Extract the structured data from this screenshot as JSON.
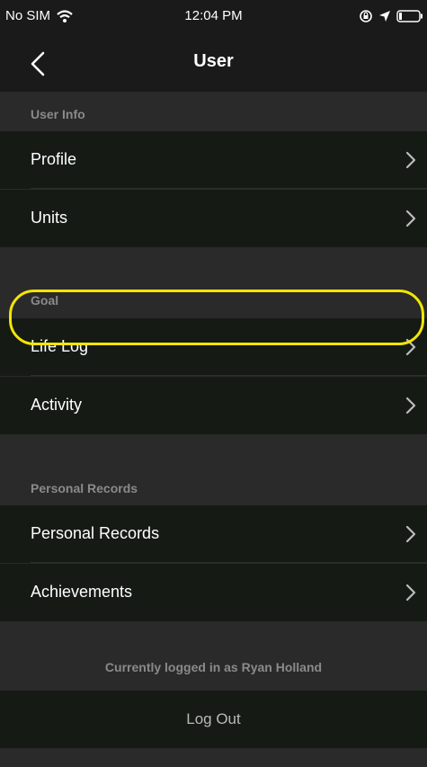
{
  "status_bar": {
    "carrier": "No SIM",
    "time": "12:04 PM",
    "icons": [
      "wifi-icon",
      "orientation-lock-icon",
      "location-arrow-icon",
      "battery-icon"
    ]
  },
  "nav": {
    "title": "User",
    "back_icon": "chevron-left-icon"
  },
  "sections": {
    "user_info": {
      "label": "User Info",
      "items": [
        {
          "label": "Profile"
        },
        {
          "label": "Units"
        }
      ]
    },
    "goal": {
      "label": "Goal",
      "items": [
        {
          "label": "Life Log"
        },
        {
          "label": "Activity"
        }
      ]
    },
    "personal_records": {
      "label": "Personal Records",
      "items": [
        {
          "label": "Personal Records"
        },
        {
          "label": "Achievements"
        }
      ]
    }
  },
  "footer": {
    "logged_in_text": "Currently logged in as Ryan Holland",
    "logout_label": "Log Out"
  },
  "colors": {
    "background": "#2a2a2a",
    "row_background": "#151a15",
    "highlight": "#f2e600",
    "muted_text": "#8a8a8a"
  }
}
